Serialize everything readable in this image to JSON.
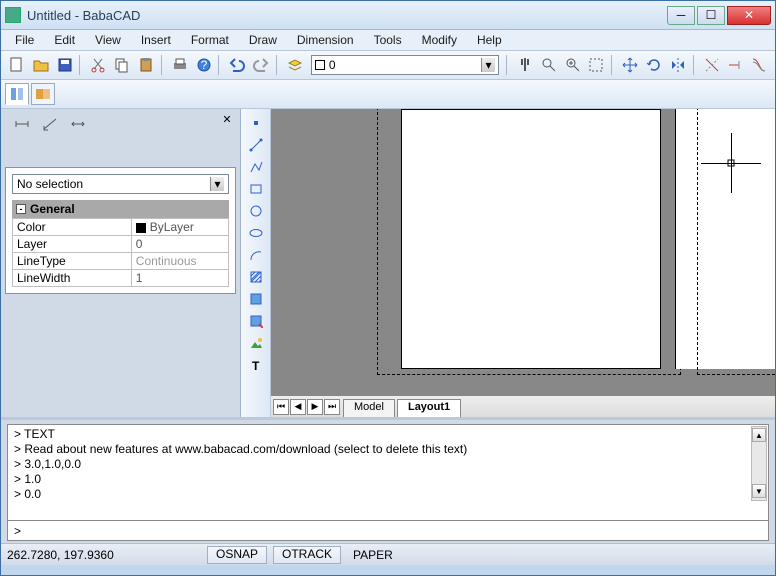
{
  "window": {
    "title": "Untitled - BabaCAD"
  },
  "menu": {
    "file": "File",
    "edit": "Edit",
    "view": "View",
    "insert": "Insert",
    "format": "Format",
    "draw": "Draw",
    "dimension": "Dimension",
    "tools": "Tools",
    "modify": "Modify",
    "help": "Help"
  },
  "toolbar": {
    "layer_value": "0"
  },
  "properties": {
    "selection": "No selection",
    "group": "General",
    "rows": [
      {
        "label": "Color",
        "value": "ByLayer"
      },
      {
        "label": "Layer",
        "value": "0"
      },
      {
        "label": "LineType",
        "value": "Continuous"
      },
      {
        "label": "LineWidth",
        "value": "1"
      }
    ]
  },
  "canvas_tabs": {
    "model": "Model",
    "layout1": "Layout1"
  },
  "command": {
    "lines": [
      "> TEXT",
      "> Read about new features at www.babacad.com/download (select to delete this text)",
      "> 3.0,1.0,0.0",
      "> 1.0",
      "> 0.0"
    ],
    "prompt": ">"
  },
  "status": {
    "coords": "262.7280, 197.9360",
    "osnap": "OSNAP",
    "otrack": "OTRACK",
    "paper": "PAPER"
  }
}
